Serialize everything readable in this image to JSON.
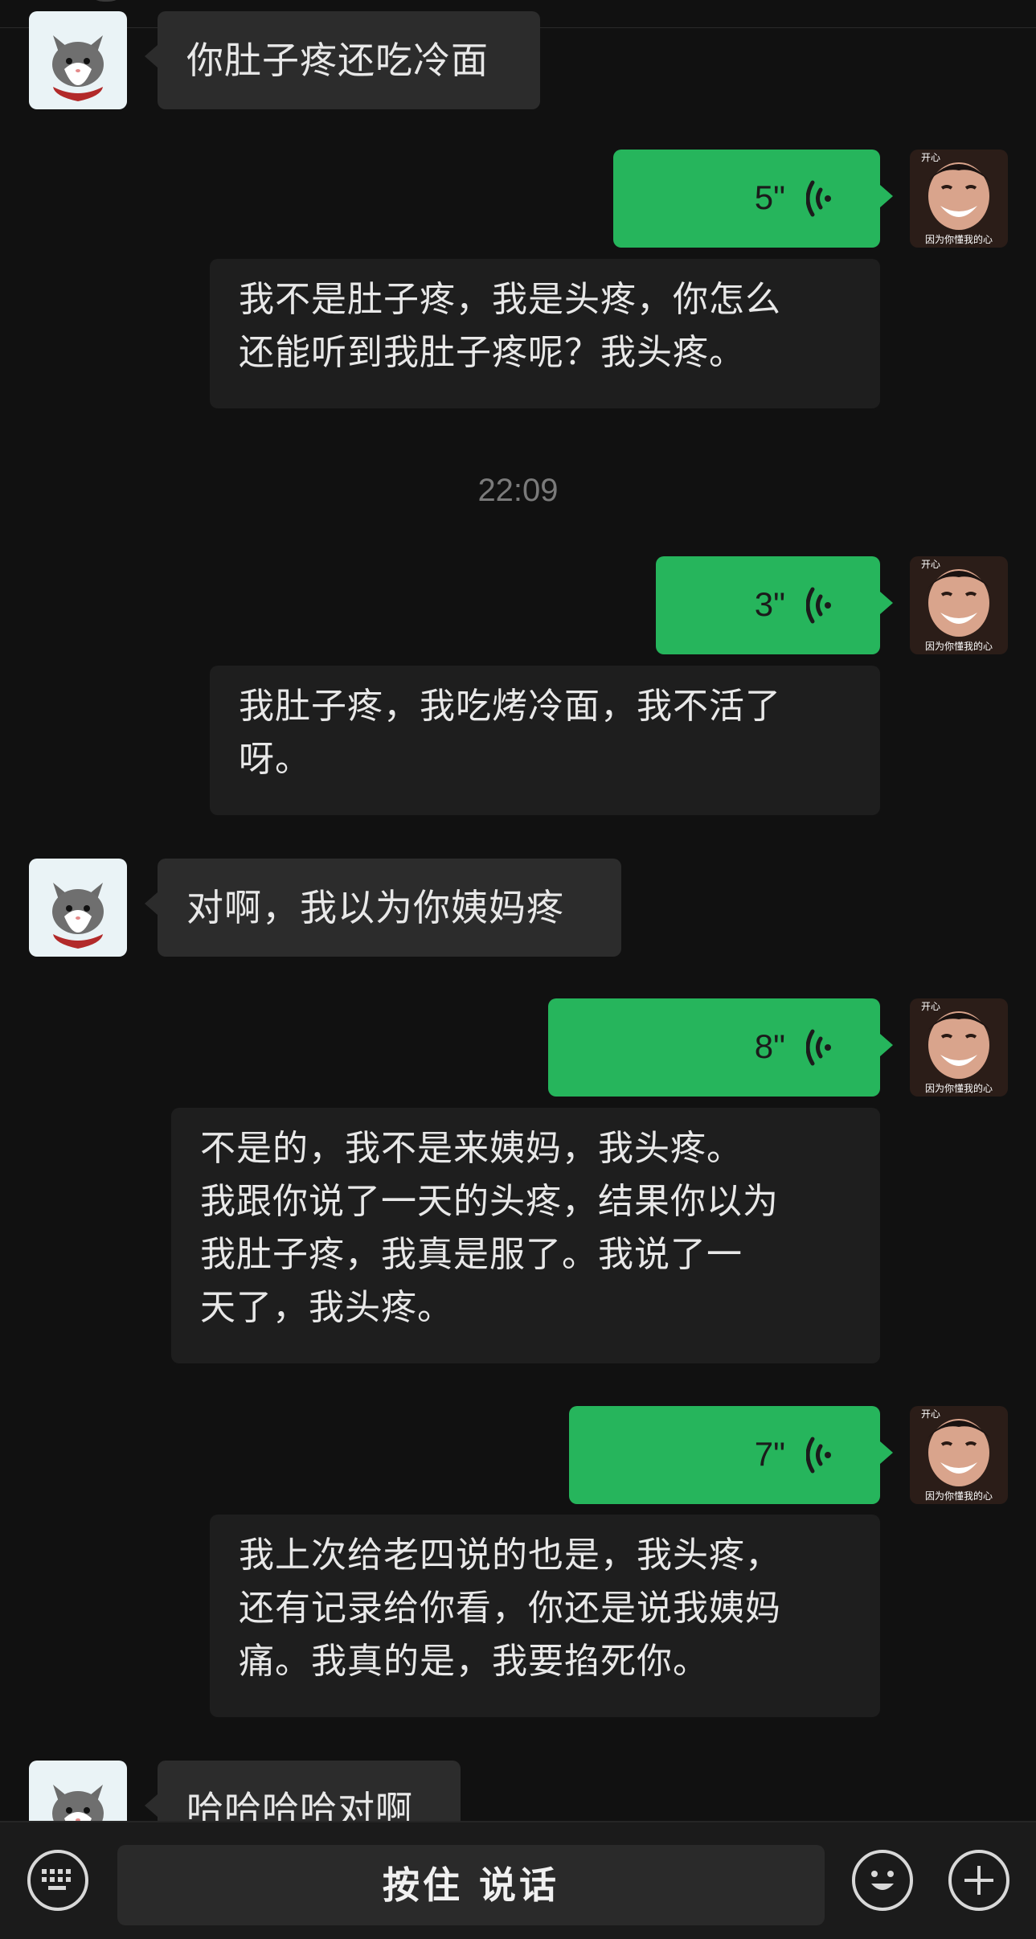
{
  "messages": {
    "m1": {
      "text": "你肚子疼还吃冷面"
    },
    "v1": {
      "duration": "5\"",
      "transcript": "我不是肚子疼，我是头疼，你怎么\n还能听到我肚子疼呢？我头疼。"
    },
    "timestamp1": "22:09",
    "v2": {
      "duration": "3\"",
      "transcript": "我肚子疼，我吃烤冷面，我不活了\n呀。"
    },
    "m2": {
      "text": "对啊，我以为你姨妈疼"
    },
    "v3": {
      "duration": "8\"",
      "transcript": "不是的，我不是来姨妈，我头疼。\n我跟你说了一天的头疼，结果你以为\n我肚子疼，我真是服了。我说了一\n天了，我头疼。"
    },
    "v4": {
      "duration": "7\"",
      "transcript": "我上次给老四说的也是，我头疼，\n还有记录给你看，你还是说我姨妈\n痛。我真的是，我要掐死你。"
    },
    "m3": {
      "text": "哈哈哈哈对啊"
    }
  },
  "avatars": {
    "contact": {
      "icon": "cat-avatar-icon"
    },
    "self": {
      "icon": "boy-sticker-avatar-icon",
      "caption": "因为你懂我的心",
      "top_caption": "开心"
    }
  },
  "input_bar": {
    "hold_to_talk_label": "按住 说话",
    "keyboard_icon": "keyboard-icon",
    "emoji_icon": "emoji-icon",
    "plus_icon": "plus-icon"
  },
  "colors": {
    "background": "#111111",
    "sent_bubble": "#26b55c",
    "received_bubble": "#2c2c2c",
    "transcript_bg": "#1e1e1e"
  }
}
